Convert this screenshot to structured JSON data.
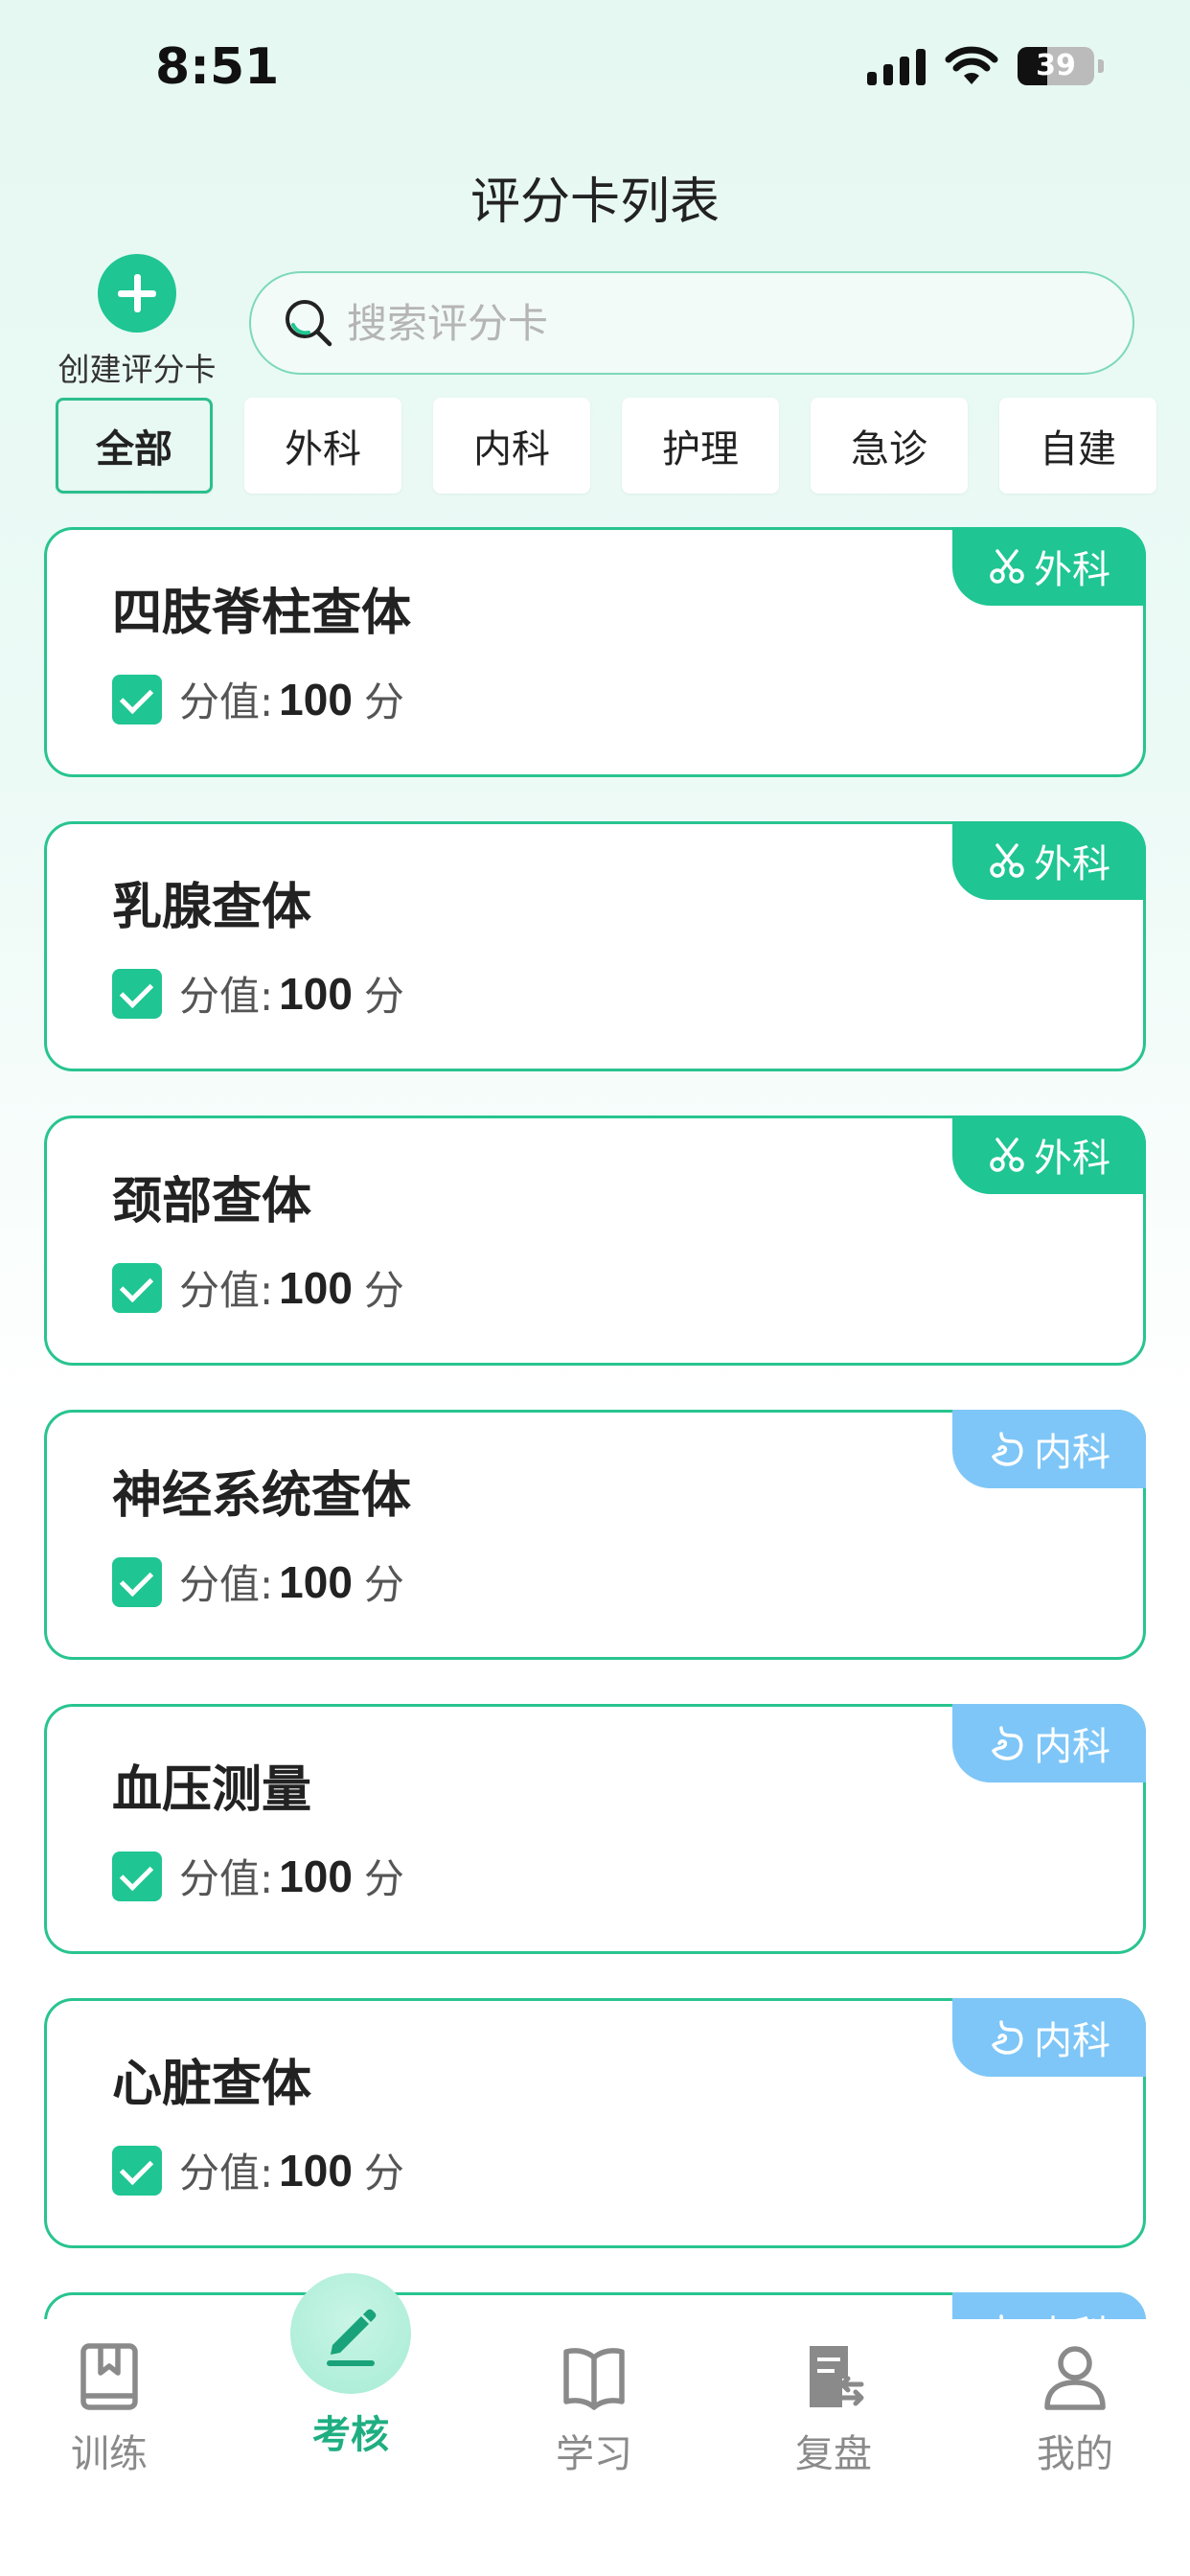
{
  "status_bar": {
    "time": "8:51",
    "battery": "39"
  },
  "header": {
    "title": "评分卡列表"
  },
  "create": {
    "label": "创建评分卡"
  },
  "search": {
    "placeholder": "搜索评分卡"
  },
  "filters": [
    {
      "label": "全部",
      "active": true
    },
    {
      "label": "外科",
      "active": false
    },
    {
      "label": "内科",
      "active": false
    },
    {
      "label": "护理",
      "active": false
    },
    {
      "label": "急诊",
      "active": false
    },
    {
      "label": "自建",
      "active": false
    }
  ],
  "cards": [
    {
      "title": "四肢脊柱查体",
      "score_label": "分值:",
      "score": "100",
      "unit": "分",
      "tag": "外科",
      "tag_type": "surgery"
    },
    {
      "title": "乳腺查体",
      "score_label": "分值:",
      "score": "100",
      "unit": "分",
      "tag": "外科",
      "tag_type": "surgery"
    },
    {
      "title": "颈部查体",
      "score_label": "分值:",
      "score": "100",
      "unit": "分",
      "tag": "外科",
      "tag_type": "surgery"
    },
    {
      "title": "神经系统查体",
      "score_label": "分值:",
      "score": "100",
      "unit": "分",
      "tag": "内科",
      "tag_type": "internal"
    },
    {
      "title": "血压测量",
      "score_label": "分值:",
      "score": "100",
      "unit": "分",
      "tag": "内科",
      "tag_type": "internal"
    },
    {
      "title": "心脏查体",
      "score_label": "分值:",
      "score": "100",
      "unit": "分",
      "tag": "内科",
      "tag_type": "internal"
    },
    {
      "title": "",
      "score_label": "",
      "score": "",
      "unit": "",
      "tag": "内科",
      "tag_type": "internal"
    }
  ],
  "tabbar": {
    "items": [
      {
        "label": "训练",
        "icon": "bookmark-book-icon",
        "active": false
      },
      {
        "label": "考核",
        "icon": "pencil-icon",
        "active": true
      },
      {
        "label": "学习",
        "icon": "open-book-icon",
        "active": false
      },
      {
        "label": "复盘",
        "icon": "review-document-icon",
        "active": false
      },
      {
        "label": "我的",
        "icon": "user-icon",
        "active": false
      }
    ]
  },
  "colors": {
    "accent": "#1fc592",
    "surgery_tag": "#1fc592",
    "internal_tag": "#7ec6f7"
  }
}
